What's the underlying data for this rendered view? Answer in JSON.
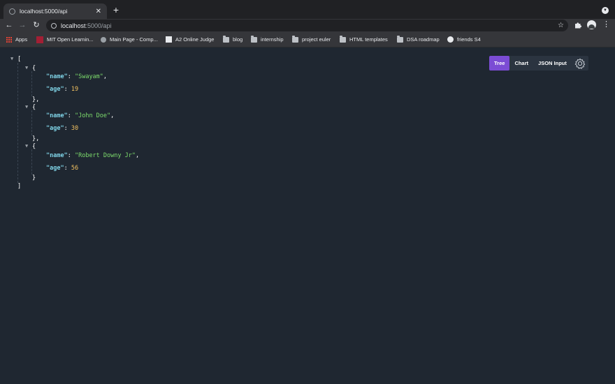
{
  "browser": {
    "tab_title": "localhost:5000/api",
    "url_host": "localhost",
    "url_path": ":5000/api",
    "bookmarks": [
      "Apps",
      "MIT Open Learnin...",
      "Main Page - Comp...",
      "A2 Online Judge",
      "blog",
      "internship",
      "project euler",
      "HTML templates",
      "DSA roadmap",
      "friends S4"
    ]
  },
  "viewer": {
    "modes": [
      "Tree",
      "Chart",
      "JSON Input"
    ],
    "active_mode": "Tree",
    "accent_color": "#7b4cd4"
  },
  "json": {
    "open_bracket": "[",
    "close_bracket": "]",
    "records": [
      {
        "key1": "\"name\"",
        "val1": "\"Swayam\"",
        "key2": "\"age\"",
        "val2": "19"
      },
      {
        "key1": "\"name\"",
        "val1": "\"John Doe\"",
        "key2": "\"age\"",
        "val2": "30"
      },
      {
        "key1": "\"name\"",
        "val1": "\"Robert Downy Jr\"",
        "key2": "\"age\"",
        "val2": "56"
      }
    ]
  }
}
